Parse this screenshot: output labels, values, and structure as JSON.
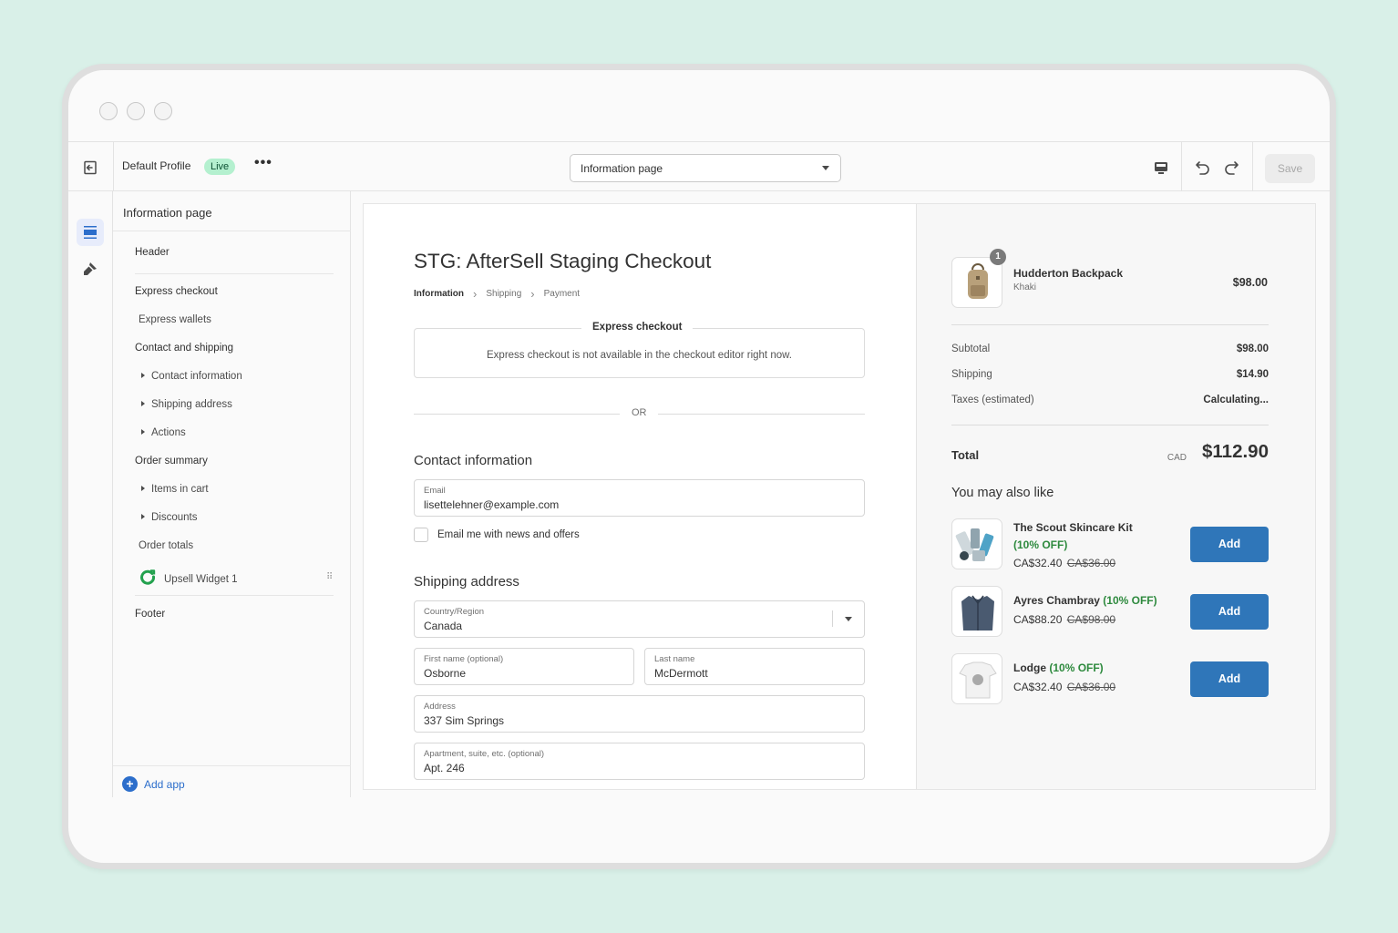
{
  "topbar": {
    "profile_name": "Default Profile",
    "status_badge": "Live",
    "more_label": "•••",
    "page_select_value": "Information page",
    "save_label": "Save"
  },
  "sidebar": {
    "title": "Information page",
    "items": [
      {
        "label": "Header"
      },
      {
        "label": "Express checkout"
      },
      {
        "label": "Express wallets"
      },
      {
        "label": "Contact and shipping"
      },
      {
        "label": "Contact information"
      },
      {
        "label": "Shipping address"
      },
      {
        "label": "Actions"
      },
      {
        "label": "Order summary"
      },
      {
        "label": "Items in cart"
      },
      {
        "label": "Discounts"
      },
      {
        "label": "Order totals"
      },
      {
        "label": "Upsell Widget 1"
      },
      {
        "label": "Footer"
      }
    ],
    "add_app_label": "Add app"
  },
  "checkout": {
    "shop_title": "STG: AfterSell Staging Checkout",
    "breadcrumbs": [
      "Information",
      "Shipping",
      "Payment"
    ],
    "express_title": "Express checkout",
    "express_message": "Express checkout is not available in the checkout editor right now.",
    "or_label": "OR",
    "contact_title": "Contact information",
    "email": {
      "label": "Email",
      "value": "lisettelehner@example.com"
    },
    "newsletter_label": "Email me with news and offers",
    "shipping_title": "Shipping address",
    "country": {
      "label": "Country/Region",
      "value": "Canada"
    },
    "first_name": {
      "label": "First name (optional)",
      "value": "Osborne"
    },
    "last_name": {
      "label": "Last name",
      "value": "McDermott"
    },
    "address": {
      "label": "Address",
      "value": "337 Sim Springs"
    },
    "apartment": {
      "label": "Apartment, suite, etc. (optional)",
      "value": "Apt. 246"
    }
  },
  "summary": {
    "product": {
      "quantity": "1",
      "name": "Hudderton Backpack",
      "variant": "Khaki",
      "price": "$98.00"
    },
    "subtotal": {
      "label": "Subtotal",
      "value": "$98.00"
    },
    "shipping": {
      "label": "Shipping",
      "value": "$14.90"
    },
    "taxes": {
      "label": "Taxes (estimated)",
      "value": "Calculating..."
    },
    "total": {
      "label": "Total",
      "currency": "CAD",
      "value": "$112.90"
    },
    "upsell_title": "You may also like",
    "upsells": [
      {
        "name": "The Scout Skincare Kit",
        "discount": "(10% OFF)",
        "price": "CA$32.40",
        "was": "CA$36.00",
        "button": "Add"
      },
      {
        "name": "Ayres Chambray",
        "discount": "(10% OFF)",
        "price": "CA$88.20",
        "was": "CA$98.00",
        "button": "Add"
      },
      {
        "name": "Lodge",
        "discount": "(10% OFF)",
        "price": "CA$32.40",
        "was": "CA$36.00",
        "button": "Add"
      }
    ]
  },
  "colors": {
    "background": "#d9f0e8",
    "accent_blue": "#2f76b9",
    "live_badge": "#b4f0cf",
    "discount_green": "#2e8a3e"
  }
}
